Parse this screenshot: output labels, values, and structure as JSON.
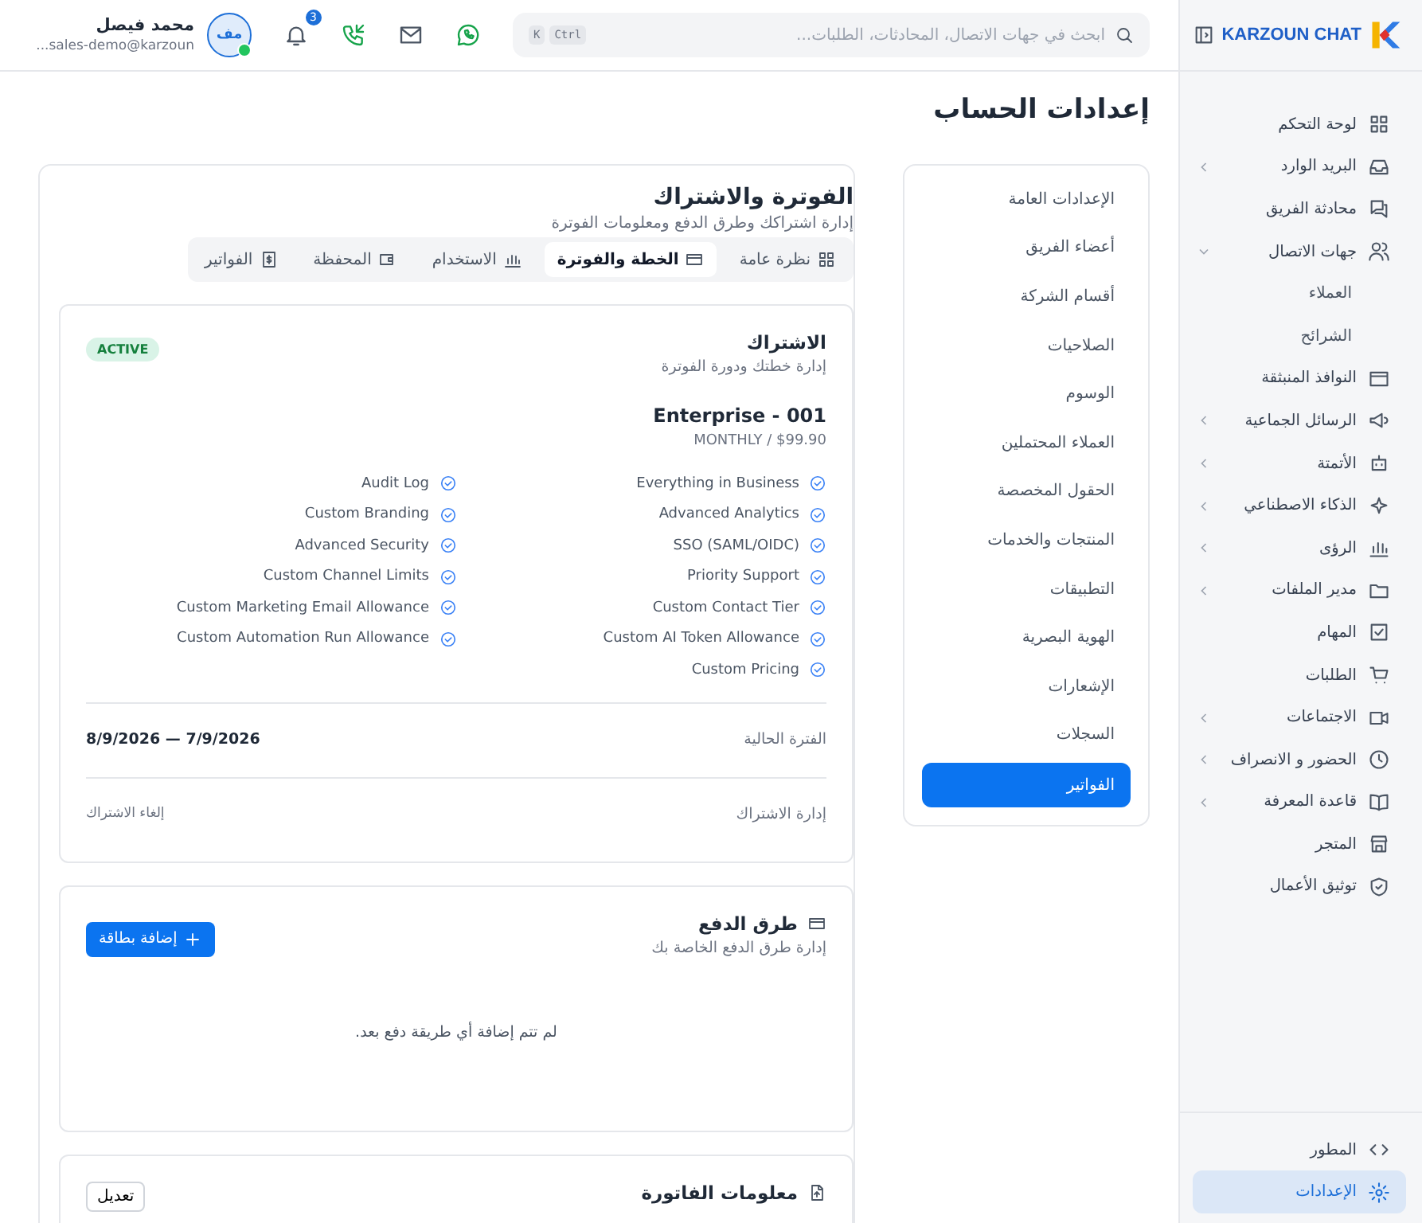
{
  "sidebar": {
    "brand": "KARZOUN CHAT",
    "items": [
      {
        "label": "لوحة التحكم",
        "selected": false
      },
      {
        "label": "البريد الوارد",
        "selected": false,
        "expanded": false
      },
      {
        "label": "محادثة الفريق",
        "selected": false
      },
      {
        "label": "جهات الاتصال",
        "selected": false,
        "expanded": true,
        "children": [
          {
            "label": "العملاء",
            "selected": false
          },
          {
            "label": "الشرائح",
            "selected": false
          }
        ]
      },
      {
        "label": "النوافذ المنبثقة",
        "selected": false
      },
      {
        "label": "الرسائل الجماعية",
        "selected": false,
        "expanded": false
      },
      {
        "label": "الأتمتة",
        "selected": false,
        "expanded": false
      },
      {
        "label": "الذكاء الاصطناعي",
        "selected": false,
        "expanded": false
      },
      {
        "label": "الرؤى",
        "selected": false,
        "expanded": false
      },
      {
        "label": "مدير الملفات",
        "selected": false,
        "expanded": false
      },
      {
        "label": "المهام",
        "selected": false
      },
      {
        "label": "الطلبات",
        "selected": false
      },
      {
        "label": "الاجتماعات",
        "selected": false,
        "expanded": false
      },
      {
        "label": "الحضور و الانصراف",
        "selected": false,
        "expanded": false
      },
      {
        "label": "قاعدة المعرفة",
        "selected": false,
        "expanded": false
      },
      {
        "label": "المتجر",
        "selected": false
      },
      {
        "label": "توثيق الأعمال",
        "selected": false
      }
    ],
    "bottom_items": [
      {
        "label": "المطور",
        "selected": false
      },
      {
        "label": "الإعدادات",
        "selected": true
      }
    ]
  },
  "header": {
    "search": {
      "placeholder": "ابحث في جهات الاتصال، المحادثات، الطلبات...",
      "shortcut": [
        "Ctrl",
        "K"
      ]
    },
    "notification_count": "3",
    "user": {
      "initials": "مف",
      "name": "محمد فيصل",
      "email": "sales-demo@karzoun...",
      "online": true
    }
  },
  "page_title": "إعدادات الحساب",
  "settings_menu": [
    {
      "label": "الإعدادات العامة",
      "selected": false
    },
    {
      "label": "أعضاء الفريق",
      "selected": false
    },
    {
      "label": "أقسام الشركة",
      "selected": false
    },
    {
      "label": "الصلاحيات",
      "selected": false
    },
    {
      "label": "الوسوم",
      "selected": false
    },
    {
      "label": "العملاء المحتملين",
      "selected": false
    },
    {
      "label": "الحقول المخصصة",
      "selected": false
    },
    {
      "label": "المنتجات والخدمات",
      "selected": false
    },
    {
      "label": "التطبيقات",
      "selected": false
    },
    {
      "label": "الهوية البصرية",
      "selected": false
    },
    {
      "label": "الإشعارات",
      "selected": false
    },
    {
      "label": "السجلات",
      "selected": false
    },
    {
      "label": "الفواتير",
      "selected": true
    }
  ],
  "billing": {
    "title": "الفوترة والاشتراك",
    "subtitle": "إدارة اشتراكك وطرق الدفع ومعلومات الفوترة",
    "tabs": [
      {
        "label": "نظرة عامة",
        "selected": false
      },
      {
        "label": "الخطة والفوترة",
        "selected": true
      },
      {
        "label": "الاستخدام",
        "selected": false
      },
      {
        "label": "المحفظة",
        "selected": false
      },
      {
        "label": "الفواتير",
        "selected": false
      }
    ],
    "subscription": {
      "title": "الاشتراك",
      "subtitle": "إدارة خطتك ودورة الفوترة",
      "status": "ACTIVE",
      "plan": "Enterprise - 001",
      "price": "MONTHLY / $99.90",
      "features": [
        "Everything in Business",
        "Advanced Analytics",
        "SSO (SAML/OIDC)",
        "Priority Support",
        "Custom Contact Tier",
        "Custom AI Token Allowance",
        "Custom Pricing",
        "Audit Log",
        "Custom Branding",
        "Advanced Security",
        "Custom Channel Limits",
        "Custom Marketing Email Allowance",
        "Custom Automation Run Allowance"
      ],
      "period_label": "الفترة الحالية",
      "period": "8/9/2026 — 7/9/2026",
      "manage_label": "إدارة الاشتراك",
      "cancel_link": "إلغاء الاشتراك"
    },
    "payment_methods": {
      "title": "طرق الدفع",
      "subtitle": "إدارة طرق الدفع الخاصة بك",
      "add_button": "إضافة بطاقة",
      "empty": "لم تتم إضافة أي طريقة دفع بعد."
    },
    "billing_info": {
      "title": "معلومات الفاتورة",
      "edit_button": "تعديل"
    }
  }
}
